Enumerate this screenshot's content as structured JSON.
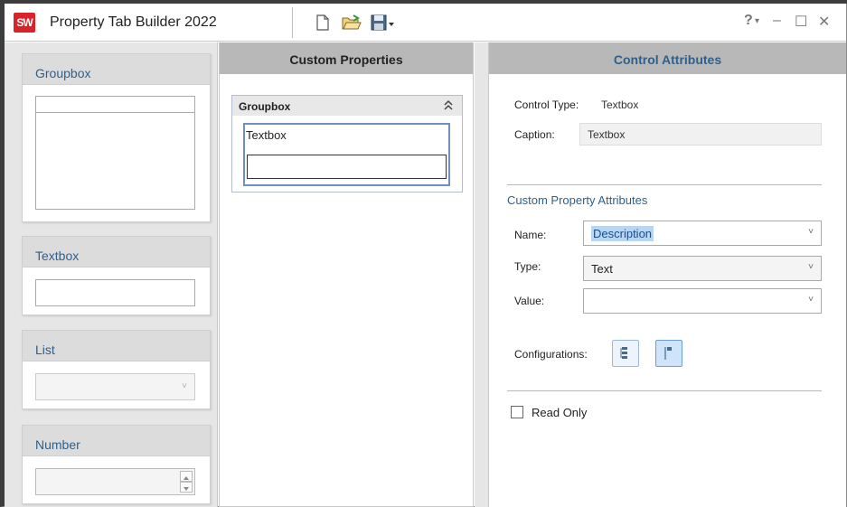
{
  "window": {
    "title": "Property Tab Builder  2022",
    "logo_text": "SW",
    "help_glyph": "?",
    "help_caret": "▾",
    "minimize_glyph": "–",
    "maximize_glyph": "☐",
    "close_glyph": "✕",
    "toolbar_icons": [
      "new-document-icon",
      "open-folder-icon",
      "save-icon",
      "save-dropdown-icon"
    ]
  },
  "palette": {
    "items": [
      {
        "label": "Groupbox"
      },
      {
        "label": "Textbox"
      },
      {
        "label": "List"
      },
      {
        "label": "Number"
      }
    ]
  },
  "custom_properties": {
    "header": "Custom Properties",
    "groupbox_title": "Groupbox",
    "collapse_glyph": "≈",
    "textbox_caption": "Textbox",
    "textbox_value": ""
  },
  "control_attributes": {
    "header": "Control Attributes",
    "control_type_label": "Control Type:",
    "control_type_value": "Textbox",
    "caption_label": "Caption:",
    "caption_value": "Textbox",
    "section_title": "Custom Property Attributes",
    "name_label": "Name:",
    "name_value": "Description",
    "type_label": "Type:",
    "type_value": "Text",
    "value_label": "Value:",
    "value_value": "",
    "configurations_label": "Configurations:",
    "read_only_label": "Read Only",
    "read_only_checked": false,
    "combo_arrow": "˅"
  },
  "colors": {
    "accent_blue": "#2f5f8a",
    "selection": "#b8d6f4",
    "logo_red": "#d8232a"
  }
}
